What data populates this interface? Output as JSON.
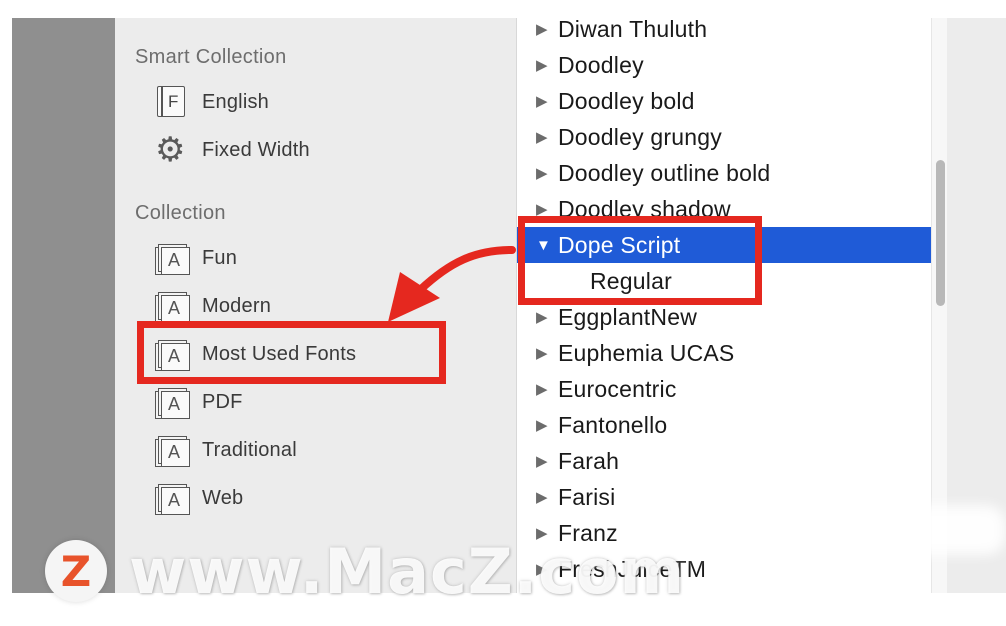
{
  "sidebar": {
    "smart_collection_title": "Smart Collection",
    "smart_items": [
      {
        "label": "English",
        "icon": "font-document-icon"
      },
      {
        "label": "Fixed Width",
        "icon": "gear-icon"
      }
    ],
    "collection_title": "Collection",
    "collection_items": [
      {
        "label": "Fun",
        "icon": "collection-stack-icon"
      },
      {
        "label": "Modern",
        "icon": "collection-stack-icon"
      },
      {
        "label": "Most Used Fonts",
        "icon": "collection-stack-icon"
      },
      {
        "label": "PDF",
        "icon": "collection-stack-icon"
      },
      {
        "label": "Traditional",
        "icon": "collection-stack-icon"
      },
      {
        "label": "Web",
        "icon": "collection-stack-icon"
      }
    ]
  },
  "font_list": {
    "rows": [
      {
        "name": "Diwan Thuluth",
        "expanded": false
      },
      {
        "name": "Doodley",
        "expanded": false
      },
      {
        "name": "Doodley bold",
        "expanded": false
      },
      {
        "name": "Doodley grungy",
        "expanded": false
      },
      {
        "name": "Doodley outline bold",
        "expanded": false
      },
      {
        "name": "Doodley shadow",
        "expanded": false
      },
      {
        "name": "Dope Script",
        "expanded": true,
        "selected": true
      },
      {
        "name": "Regular",
        "is_style": true
      },
      {
        "name": "EggplantNew",
        "expanded": false
      },
      {
        "name": "Euphemia UCAS",
        "expanded": false
      },
      {
        "name": "Eurocentric",
        "expanded": false
      },
      {
        "name": "Fantonello",
        "expanded": false
      },
      {
        "name": "Farah",
        "expanded": false
      },
      {
        "name": "Farisi",
        "expanded": false
      },
      {
        "name": "Franz",
        "expanded": false
      },
      {
        "name": "FreshJuiceTM",
        "expanded": false
      }
    ]
  },
  "watermark": {
    "logo_letter": "Z",
    "text": "www.MacZ.com"
  },
  "colors": {
    "selection": "#1f5bd7",
    "highlight": "#e5281f",
    "sidebar_bg": "#ececec",
    "logo": "#e8532b"
  }
}
